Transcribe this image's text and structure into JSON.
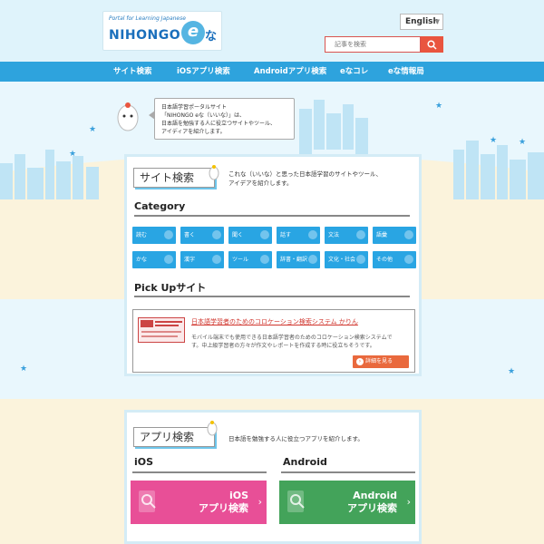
{
  "logo": {
    "tagline": "Portal for Learning Japanese",
    "wordmark": "NIHONGO",
    "e": "e",
    "na": "な"
  },
  "language": {
    "selected": "English"
  },
  "search": {
    "placeholder": "記事を検索"
  },
  "nav": {
    "items": [
      {
        "label": "サイト検索"
      },
      {
        "label": "iOSアプリ検索"
      },
      {
        "label": "Androidアプリ検索"
      },
      {
        "label": "eなコレ"
      },
      {
        "label": "eな情報局"
      }
    ]
  },
  "intro": {
    "lines": [
      "日本語学習ポータルサイト",
      "「NIHONGO eな（いいな）」は、",
      "日本語を勉強する人に役立つサイトやツール、",
      "アイディアを紹介します。"
    ]
  },
  "site_search": {
    "title": "サイト検索",
    "desc_lines": [
      "これな（いいな）と思った日本語学習のサイトやツール、",
      "アイデアを紹介します。"
    ],
    "category_heading": "Category",
    "categories": [
      {
        "label": "読む"
      },
      {
        "label": "書く"
      },
      {
        "label": "聞く"
      },
      {
        "label": "話す"
      },
      {
        "label": "文法"
      },
      {
        "label": "語彙"
      },
      {
        "label": "かな"
      },
      {
        "label": "漢字"
      },
      {
        "label": "ツール"
      },
      {
        "label": "辞書・翻訳"
      },
      {
        "label": "文化・社会"
      },
      {
        "label": "その他"
      }
    ],
    "pickup_heading": "Pick Upサイト",
    "pickup": {
      "title": "日本語学習者のためのコロケーション検索システム かりん",
      "desc_lines": [
        "モバイル端末でも使用できる日本語学習者のためのコロケーション検索システムで",
        "す。中上級学習者の方々が作文やレポートを作成する時に役立ちそうです。"
      ],
      "button": "詳細を見る"
    }
  },
  "app_search": {
    "title": "アプリ検索",
    "desc": "日本語を勉強する人に役立つアプリを紹介します。",
    "ios": {
      "heading": "iOS",
      "line1": "iOS",
      "line2": "アプリ検索"
    },
    "android": {
      "heading": "Android",
      "line1": "Android",
      "line2": "アプリ検索"
    }
  },
  "colors": {
    "nav": "#2ea3dd",
    "category": "#29a5e3",
    "ios": "#e84f97",
    "android": "#43a35a",
    "accent": "#e9553f"
  }
}
